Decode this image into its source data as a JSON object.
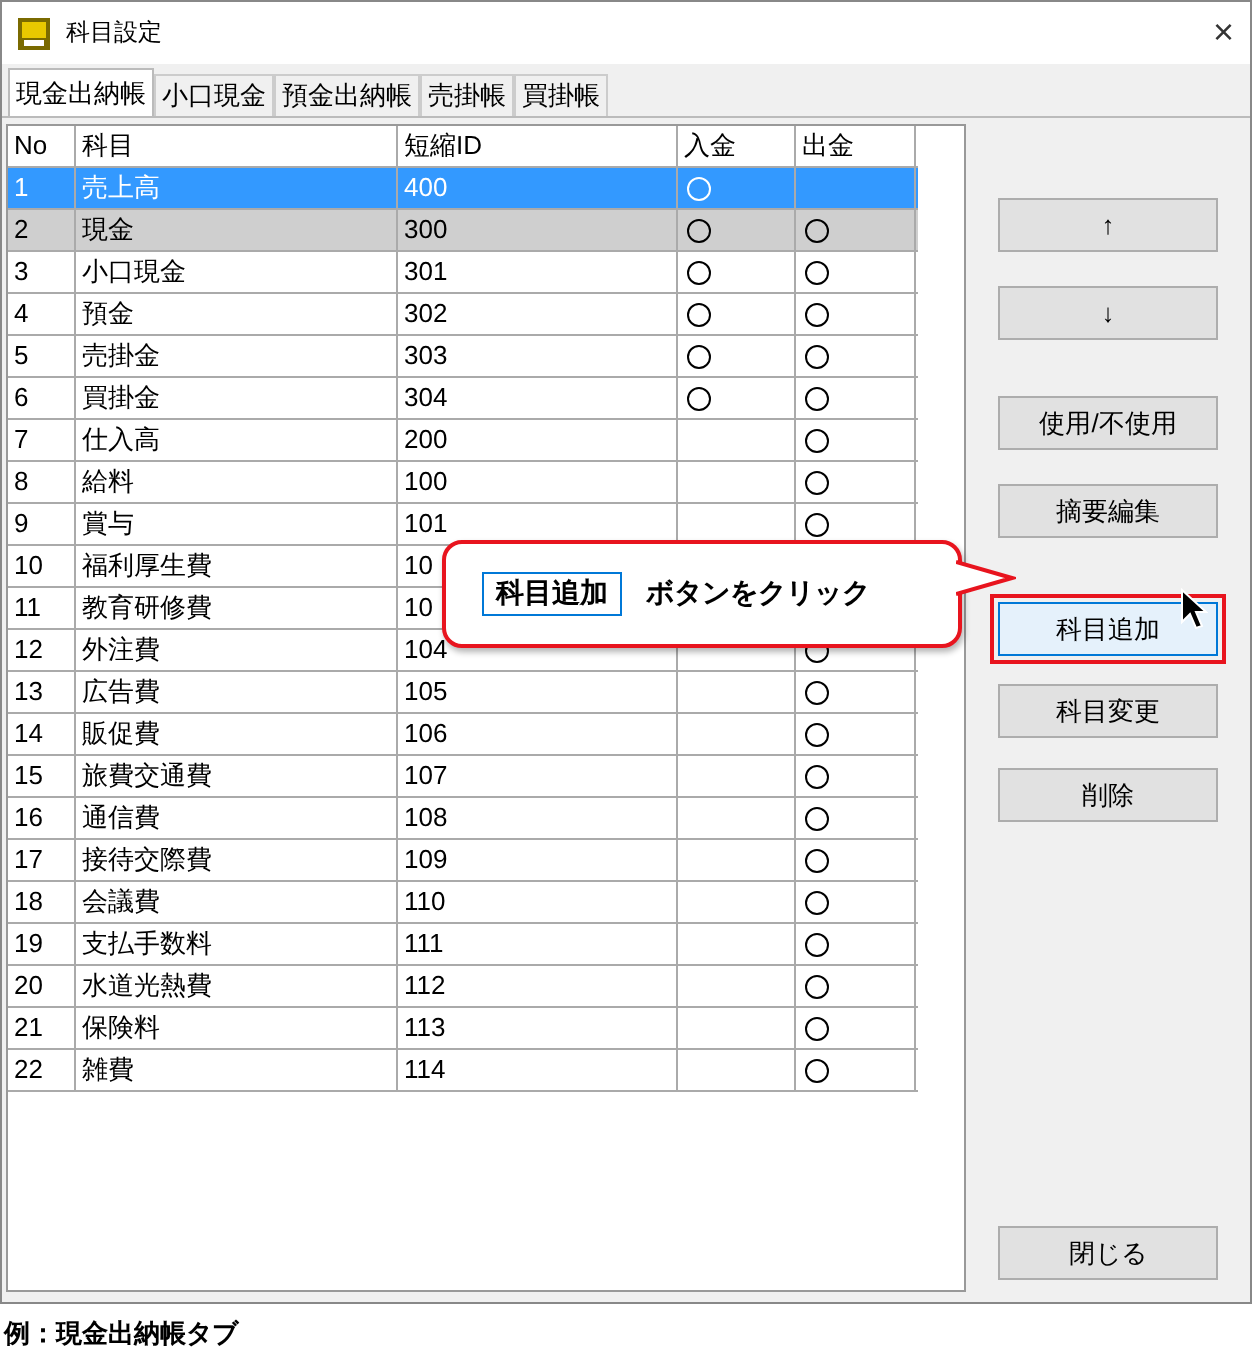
{
  "window": {
    "title": "科目設定",
    "close": "×"
  },
  "tabs": [
    {
      "label": "現金出納帳",
      "selected": true
    },
    {
      "label": "小口現金",
      "selected": false
    },
    {
      "label": "預金出納帳",
      "selected": false
    },
    {
      "label": "売掛帳",
      "selected": false
    },
    {
      "label": "買掛帳",
      "selected": false
    }
  ],
  "table": {
    "columns": [
      "No",
      "科目",
      "短縮ID",
      "入金",
      "出金"
    ],
    "rows": [
      {
        "no": "1",
        "name": "売上高",
        "id": "400",
        "in": true,
        "out": false,
        "selected": true,
        "highlighted": false
      },
      {
        "no": "2",
        "name": "現金",
        "id": "300",
        "in": true,
        "out": true,
        "selected": false,
        "highlighted": true
      },
      {
        "no": "3",
        "name": "小口現金",
        "id": "301",
        "in": true,
        "out": true,
        "selected": false,
        "highlighted": false
      },
      {
        "no": "4",
        "name": "預金",
        "id": "302",
        "in": true,
        "out": true,
        "selected": false,
        "highlighted": false
      },
      {
        "no": "5",
        "name": "売掛金",
        "id": "303",
        "in": true,
        "out": true,
        "selected": false,
        "highlighted": false
      },
      {
        "no": "6",
        "name": "買掛金",
        "id": "304",
        "in": true,
        "out": true,
        "selected": false,
        "highlighted": false
      },
      {
        "no": "7",
        "name": "仕入高",
        "id": "200",
        "in": false,
        "out": true,
        "selected": false,
        "highlighted": false
      },
      {
        "no": "8",
        "name": "給料",
        "id": "100",
        "in": false,
        "out": true,
        "selected": false,
        "highlighted": false
      },
      {
        "no": "9",
        "name": "賞与",
        "id": "101",
        "in": false,
        "out": true,
        "selected": false,
        "highlighted": false
      },
      {
        "no": "10",
        "name": "福利厚生費",
        "id": "10",
        "selected": false,
        "highlighted": false
      },
      {
        "no": "11",
        "name": "教育研修費",
        "id": "10",
        "selected": false,
        "highlighted": false
      },
      {
        "no": "12",
        "name": "外注費",
        "id": "104",
        "in": false,
        "out": true,
        "selected": false,
        "highlighted": false
      },
      {
        "no": "13",
        "name": "広告費",
        "id": "105",
        "in": false,
        "out": true,
        "selected": false,
        "highlighted": false
      },
      {
        "no": "14",
        "name": "販促費",
        "id": "106",
        "in": false,
        "out": true,
        "selected": false,
        "highlighted": false
      },
      {
        "no": "15",
        "name": "旅費交通費",
        "id": "107",
        "in": false,
        "out": true,
        "selected": false,
        "highlighted": false
      },
      {
        "no": "16",
        "name": "通信費",
        "id": "108",
        "in": false,
        "out": true,
        "selected": false,
        "highlighted": false
      },
      {
        "no": "17",
        "name": "接待交際費",
        "id": "109",
        "in": false,
        "out": true,
        "selected": false,
        "highlighted": false
      },
      {
        "no": "18",
        "name": "会議費",
        "id": "110",
        "in": false,
        "out": true,
        "selected": false,
        "highlighted": false
      },
      {
        "no": "19",
        "name": "支払手数料",
        "id": "111",
        "in": false,
        "out": true,
        "selected": false,
        "highlighted": false
      },
      {
        "no": "20",
        "name": "水道光熱費",
        "id": "112",
        "in": false,
        "out": true,
        "selected": false,
        "highlighted": false
      },
      {
        "no": "21",
        "name": "保険料",
        "id": "113",
        "in": false,
        "out": true,
        "selected": false,
        "highlighted": false
      },
      {
        "no": "22",
        "name": "雑費",
        "id": "114",
        "in": false,
        "out": true,
        "selected": false,
        "highlighted": false
      }
    ]
  },
  "buttons": [
    {
      "label": "↑",
      "highlighted": false
    },
    {
      "label": "↓",
      "highlighted": false
    },
    {
      "label": "使用/不使用",
      "highlighted": false
    },
    {
      "label": "摘要編集",
      "highlighted": false
    },
    {
      "label": "科目追加",
      "highlighted": true
    },
    {
      "label": "科目変更",
      "highlighted": false
    },
    {
      "label": "削除",
      "highlighted": false
    }
  ],
  "close_button": "閉じる",
  "callout": {
    "button_name": "科目追加",
    "text": "ボタンをクリック"
  },
  "caption": "例：現金出納帳タブ"
}
